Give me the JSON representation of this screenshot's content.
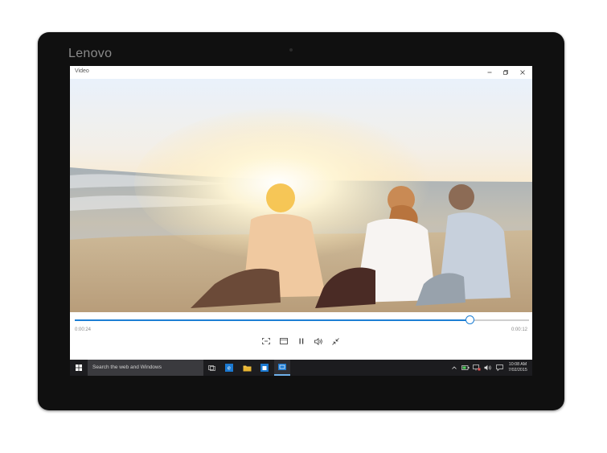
{
  "device": {
    "brand": "Lenovo"
  },
  "window": {
    "title": "Video",
    "controls": {
      "minimize": "minimize",
      "restore": "restore",
      "close": "close"
    }
  },
  "player": {
    "elapsed": "0:00:24",
    "remaining": "0:00:12",
    "progress": 0.87,
    "buttons": [
      "fullscreen-icon",
      "aspect-ratio-icon",
      "pause-icon",
      "volume-icon",
      "compact-overlay-icon"
    ]
  },
  "taskbar": {
    "search_placeholder": "Search the web and Windows",
    "pinned": [
      "task-view-icon",
      "edge-icon",
      "file-explorer-icon",
      "store-icon",
      "video-app-icon"
    ],
    "tray": [
      "chevron-up-icon",
      "battery-icon",
      "network-icon",
      "volume-icon",
      "notifications-icon"
    ],
    "time": "10:08 AM",
    "date": "7/02/2015"
  },
  "colors": {
    "accent": "#1d7fd4",
    "taskbar": "#1c1c1f",
    "bezel": "#101010"
  }
}
